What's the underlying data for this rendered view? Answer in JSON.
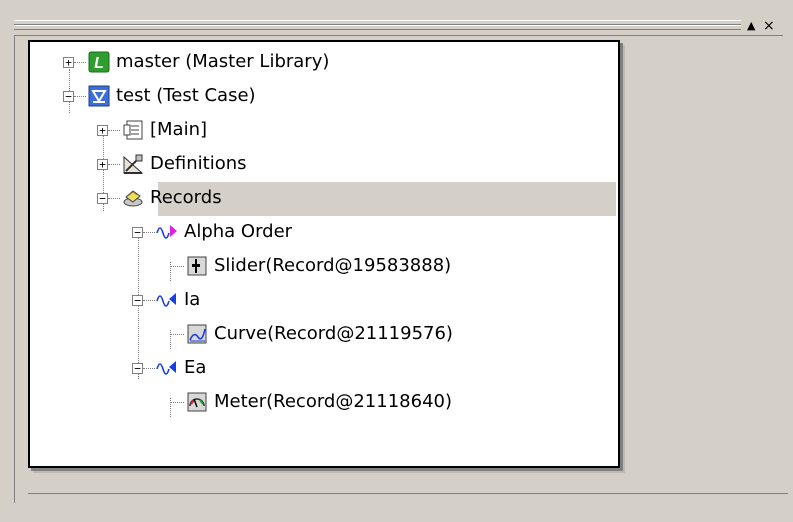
{
  "window": {
    "title_buttons": {
      "collapse": "▲",
      "close": "×"
    }
  },
  "tree": {
    "nodes": [
      {
        "label": "master (Master Library)",
        "icon": "library-icon",
        "expander": "+"
      },
      {
        "label": "test (Test Case)",
        "icon": "test-case-icon",
        "expander": "−"
      },
      {
        "label": "[Main]",
        "icon": "main-module-icon",
        "expander": "+"
      },
      {
        "label": "Definitions",
        "icon": "definitions-icon",
        "expander": "+"
      },
      {
        "label": "Records",
        "icon": "records-icon",
        "expander": "−",
        "selected": true
      },
      {
        "label": "Alpha Order",
        "icon": "signal-icon",
        "expander": "−"
      },
      {
        "label": "Slider(Record@19583888)",
        "icon": "slider-icon"
      },
      {
        "label": "Ia",
        "icon": "signal-icon",
        "expander": "−"
      },
      {
        "label": "Curve(Record@21119576)",
        "icon": "curve-icon"
      },
      {
        "label": "Ea",
        "icon": "signal-icon",
        "expander": "−"
      },
      {
        "label": "Meter(Record@21118640)",
        "icon": "meter-icon"
      }
    ]
  },
  "colors": {
    "selection": "#d4d0c8",
    "library_icon": "#2f9e2f",
    "test_case_icon": "#3a6fd8",
    "signal_blue": "#1a3fe0",
    "signal_magenta": "#e020e0"
  }
}
